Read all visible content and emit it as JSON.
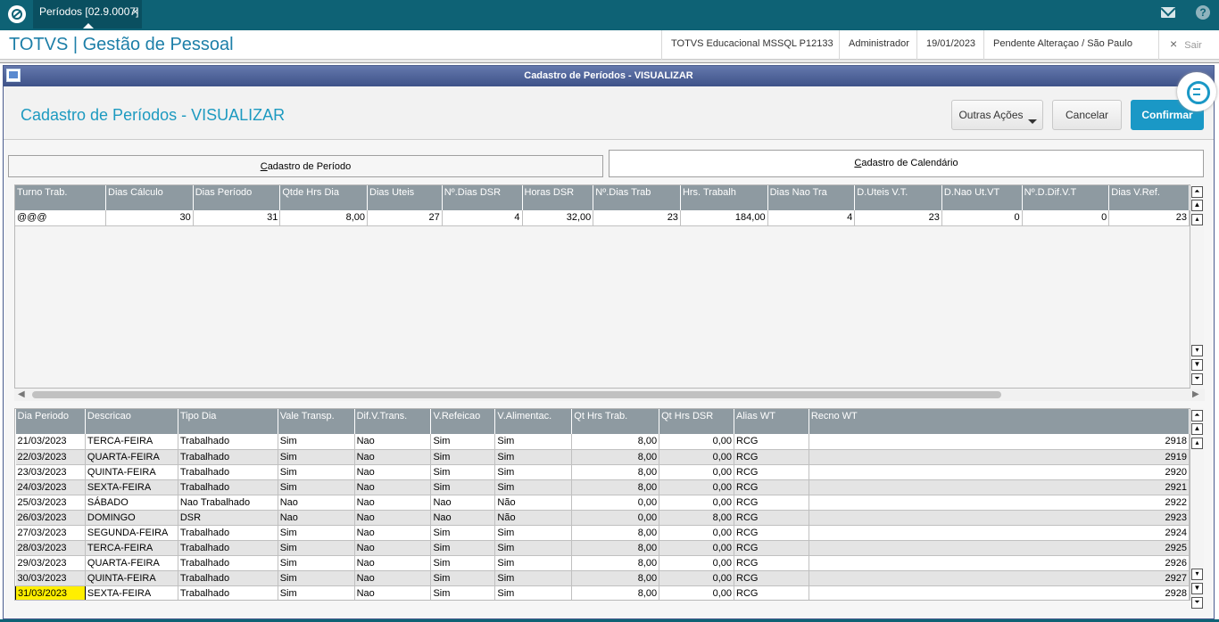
{
  "topbar": {
    "tab_label": "Períodos [02.9.0007]",
    "tab_close": "×",
    "help_glyph": "?"
  },
  "header": {
    "app_title": "TOTVS | Gestão de Pessoal",
    "environment": "TOTVS Educacional MSSQL P12133",
    "user": "Administrador",
    "date": "19/01/2023",
    "status": "Pendente Alteraçao / São Paulo",
    "exit_label": "Sair",
    "exit_icon": "×"
  },
  "window": {
    "title": "Cadastro de Períodos - VISUALIZAR"
  },
  "page": {
    "title": "Cadastro de Períodos - VISUALIZAR",
    "buttons": {
      "other_actions": "Outras Ações",
      "cancel": "Cancelar",
      "confirm": "Confirmar"
    }
  },
  "folders": {
    "period": {
      "first": "C",
      "rest": "adastro de Período"
    },
    "calendar": {
      "first": "C",
      "rest": "adastro de Calendário"
    }
  },
  "period_grid": {
    "headers": [
      "Turno Trab.",
      "Dias Cálculo",
      "Dias Período",
      "Qtde Hrs Dia",
      "Dias Uteis",
      "Nº.Dias DSR",
      "Horas DSR",
      "Nº.Dias Trab",
      "Hrs. Trabalh",
      "Dias Nao Tra",
      "D.Uteis V.T.",
      "D.Nao Ut.VT",
      "Nº.D.Dif.V.T",
      "Dias V.Ref."
    ],
    "rows": [
      [
        "@@@",
        "30",
        "31",
        "8,00",
        "27",
        "4",
        "32,00",
        "23",
        "184,00",
        "4",
        "23",
        "0",
        "0",
        "23"
      ]
    ]
  },
  "calendar_grid": {
    "headers": [
      "Dia Periodo",
      "Descricao",
      "Tipo Dia",
      "Vale Transp.",
      "Dif.V.Trans.",
      "V.Refeicao",
      "V.Alimentac.",
      "Qt Hrs Trab.",
      "Qt Hrs DSR",
      "Alias WT",
      "Recno WT"
    ],
    "rows": [
      [
        "21/03/2023",
        "TERCA-FEIRA",
        "Trabalhado",
        "Sim",
        "Nao",
        "Sim",
        "Sim",
        "8,00",
        "0,00",
        "RCG",
        "2918"
      ],
      [
        "22/03/2023",
        "QUARTA-FEIRA",
        "Trabalhado",
        "Sim",
        "Nao",
        "Sim",
        "Sim",
        "8,00",
        "0,00",
        "RCG",
        "2919"
      ],
      [
        "23/03/2023",
        "QUINTA-FEIRA",
        "Trabalhado",
        "Sim",
        "Nao",
        "Sim",
        "Sim",
        "8,00",
        "0,00",
        "RCG",
        "2920"
      ],
      [
        "24/03/2023",
        "SEXTA-FEIRA",
        "Trabalhado",
        "Sim",
        "Nao",
        "Sim",
        "Sim",
        "8,00",
        "0,00",
        "RCG",
        "2921"
      ],
      [
        "25/03/2023",
        "SÁBADO",
        "Nao Trabalhado",
        "Nao",
        "Nao",
        "Nao",
        "Não",
        "0,00",
        "0,00",
        "RCG",
        "2922"
      ],
      [
        "26/03/2023",
        "DOMINGO",
        "DSR",
        "Nao",
        "Nao",
        "Nao",
        "Não",
        "0,00",
        "8,00",
        "RCG",
        "2923"
      ],
      [
        "27/03/2023",
        "SEGUNDA-FEIRA",
        "Trabalhado",
        "Sim",
        "Nao",
        "Sim",
        "Sim",
        "8,00",
        "0,00",
        "RCG",
        "2924"
      ],
      [
        "28/03/2023",
        "TERCA-FEIRA",
        "Trabalhado",
        "Sim",
        "Nao",
        "Sim",
        "Sim",
        "8,00",
        "0,00",
        "RCG",
        "2925"
      ],
      [
        "29/03/2023",
        "QUARTA-FEIRA",
        "Trabalhado",
        "Sim",
        "Nao",
        "Sim",
        "Sim",
        "8,00",
        "0,00",
        "RCG",
        "2926"
      ],
      [
        "30/03/2023",
        "QUINTA-FEIRA",
        "Trabalhado",
        "Sim",
        "Nao",
        "Sim",
        "Sim",
        "8,00",
        "0,00",
        "RCG",
        "2927"
      ],
      [
        "31/03/2023",
        "SEXTA-FEIRA",
        "Trabalhado",
        "Sim",
        "Nao",
        "Sim",
        "Sim",
        "8,00",
        "0,00",
        "RCG",
        "2928"
      ]
    ],
    "selected_row": 10
  },
  "colors": {
    "topbar": "#0e6275",
    "accent": "#1a98c6",
    "window_title": "#4a5c8f",
    "grid_header": "#8e9aa1",
    "selection": "#ffef00"
  },
  "icons": [
    "totvs-logo-icon",
    "close-icon",
    "mail-icon",
    "help-icon",
    "window-icon",
    "chat-icon",
    "caret-down-icon"
  ]
}
